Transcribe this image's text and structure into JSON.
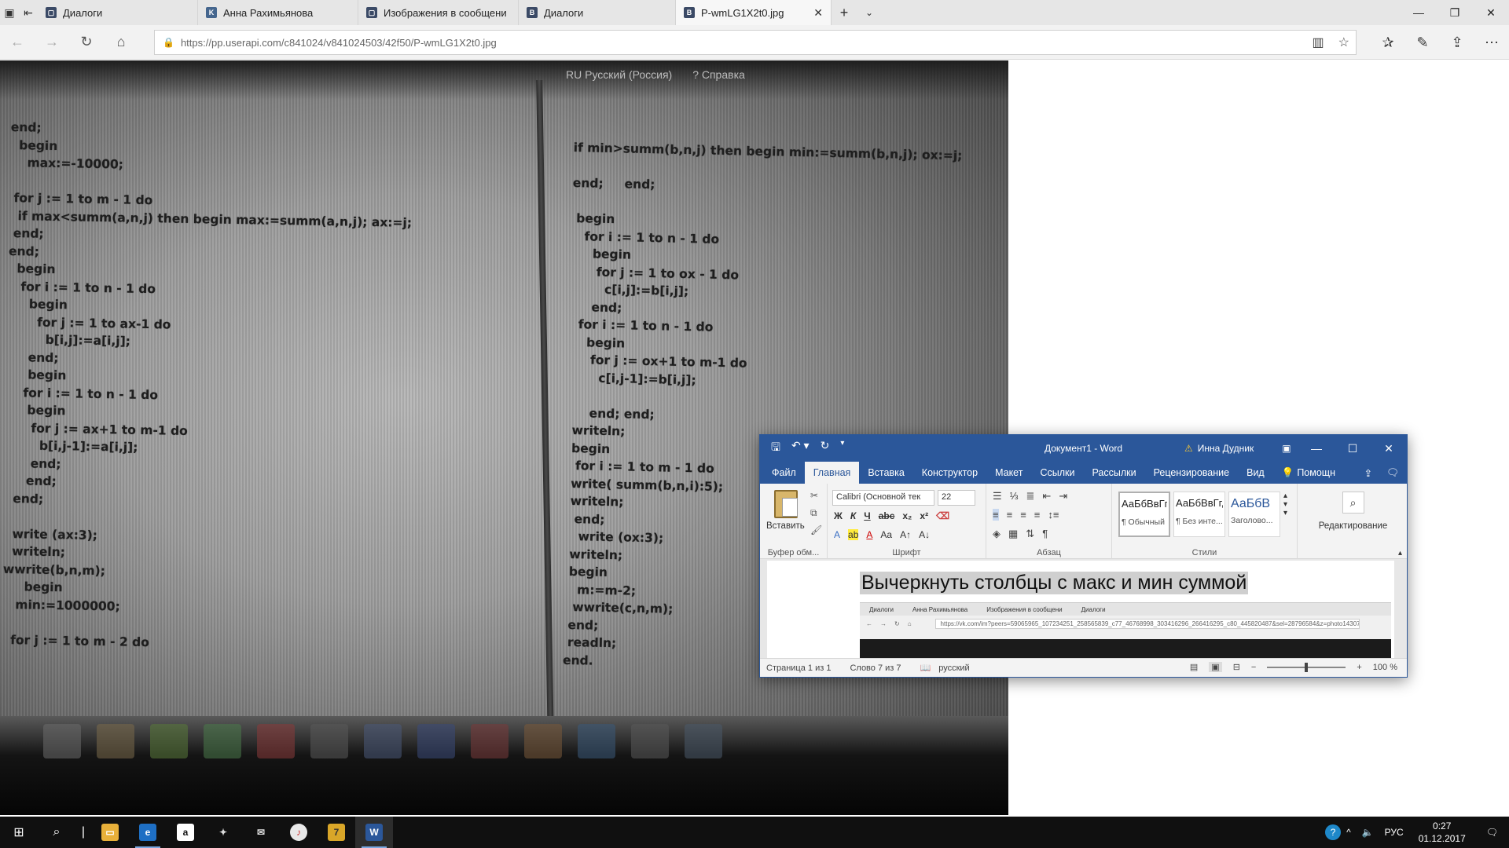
{
  "browser": {
    "tabs": [
      {
        "title": "Диалоги",
        "icon": "vk-icon",
        "color": "#3b4a66"
      },
      {
        "title": "Анна Рахимьянова",
        "icon": "vk-icon",
        "color": "#45668e"
      },
      {
        "title": "Изображения в сообщени",
        "icon": "vk-icon",
        "color": "#3b4a66"
      },
      {
        "title": "Диалоги",
        "icon": "vk-icon",
        "color": "#3b4a66"
      },
      {
        "title": "P-wmLG1X2t0.jpg",
        "icon": "vk-icon",
        "color": "#3b4a66"
      }
    ],
    "url": "https://pp.userapi.com/c841024/v841024503/42f50/P-wmLG1X2t0.jpg"
  },
  "photo": {
    "lang_label": "RU Русский (Россия)",
    "help_label": "? Справка",
    "code_left": "end;\n  begin\n    max:=-10000;\n\n for j := 1 to m - 1 do\n  if max<summ(a,n,j) then begin max:=summ(a,n,j); ax:=j;\n end;\nend;\n  begin\n   for i := 1 to n - 1 do\n     begin\n       for j := 1 to ax-1 do\n         b[i,j]:=a[i,j];\n     end;\n     begin\n    for i := 1 to n - 1 do\n     begin\n      for j := ax+1 to m-1 do\n        b[i,j-1]:=a[i,j];\n      end;\n     end;\n  end;\n\n  write (ax:3);\n  writeln;\nwwrite(b,n,m);\n     begin\n   min:=1000000;\n\n  for j := 1 to m - 2 do",
    "code_right": "if min>summ(b,n,j) then begin min:=summ(b,n,j); ox:=j;\n\nend;     end;\n\n begin\n   for i := 1 to n - 1 do\n     begin\n      for j := 1 to ox - 1 do\n        c[i,j]:=b[i,j];\n     end;\n  for i := 1 to n - 1 do\n    begin\n     for j := ox+1 to m-1 do\n       c[i,j-1]:=b[i,j];\n\n     end; end;\n writeln;\n begin\n  for i := 1 to m - 1 do\n write( summ(b,n,i):5);\n writeln;\n  end;\n   write (ox:3);\n writeln;\n begin\n   m:=m-2;\n  wwrite(c,n,m);\n end;\n readln;\nend."
  },
  "word": {
    "doc_title": "Документ1  -  Word",
    "user": "Инна Дудник",
    "tabs": [
      "Файл",
      "Главная",
      "Вставка",
      "Конструктор",
      "Макет",
      "Ссылки",
      "Рассылки",
      "Рецензирование",
      "Вид"
    ],
    "active_tab": "Главная",
    "help": "Помощн",
    "groups": {
      "clipboard": "Буфер обм...",
      "font": "Шрифт",
      "paragraph": "Абзац",
      "styles": "Стили"
    },
    "paste_label": "Вставить",
    "font_name": "Calibri (Основной тек",
    "font_size": "22",
    "styles": [
      {
        "sample": "АаБбВвГг,",
        "name": "¶ Обычный"
      },
      {
        "sample": "АаБбВвГг,",
        "name": "¶ Без инте..."
      },
      {
        "sample": "АаБбВ",
        "name": "Заголово..."
      }
    ],
    "editing_label": "Редактирование",
    "doc_heading": "Вычеркнуть столбцы с макс и мин суммой",
    "embedded": {
      "tabs": [
        "Диалоги",
        "Анна Рахимьянова",
        "Изображения в сообщени",
        "Диалоги"
      ],
      "url": "https://vk.com/im?peers=59065965_107234251_258565839_c77_46768998_303416296_266416295_c80_445820487&sel=28796584&z=photo143073654_4"
    },
    "status": {
      "page": "Страница 1 из 1",
      "words": "Слово 7 из 7",
      "lang": "русский",
      "zoom": "100 %"
    }
  },
  "taskbar": {
    "lang": "РУС",
    "time": "0:27",
    "date": "01.12.2017"
  }
}
